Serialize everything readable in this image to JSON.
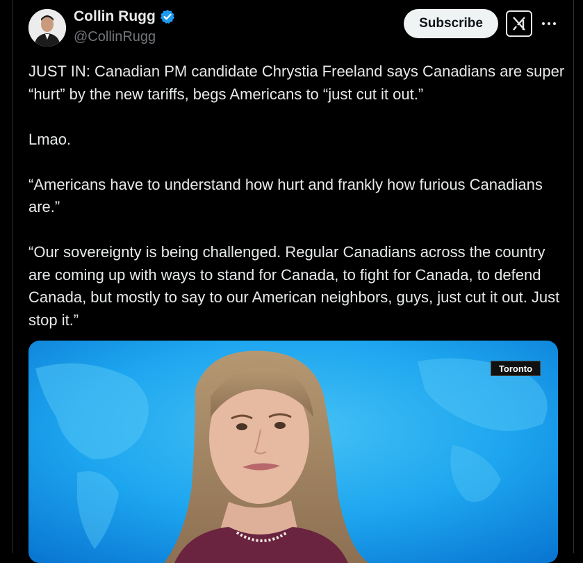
{
  "author": {
    "display_name": "Collin Rugg",
    "handle": "@CollinRugg",
    "verified_icon": "verified-badge-icon",
    "avatar_icon": "avatar-photo"
  },
  "actions": {
    "subscribe_label": "Subscribe",
    "grok_icon": "grok-icon",
    "more_icon": "more-options-icon"
  },
  "post": {
    "paragraphs": [
      "JUST IN: Canadian PM candidate Chrystia Freeland says Canadians are super “hurt” by the new tariffs, begs Americans to “just cut it out.”",
      "Lmao.",
      "“Americans have to understand how hurt and frankly how furious Canadians are.”",
      "“Our sovereignty is being challenged. Regular Canadians across the country are coming up with ways to stand for Canada, to fight for Canada, to defend Canada, but mostly to say to our American neighbors, guys, just cut it out. Just stop it.”"
    ]
  },
  "media": {
    "location_label": "Toronto"
  },
  "colors": {
    "background": "#000000",
    "text": "#e7e9ea",
    "muted": "#71767b",
    "verified_blue": "#1d9bf0",
    "media_blue": "#1ea7f0"
  }
}
